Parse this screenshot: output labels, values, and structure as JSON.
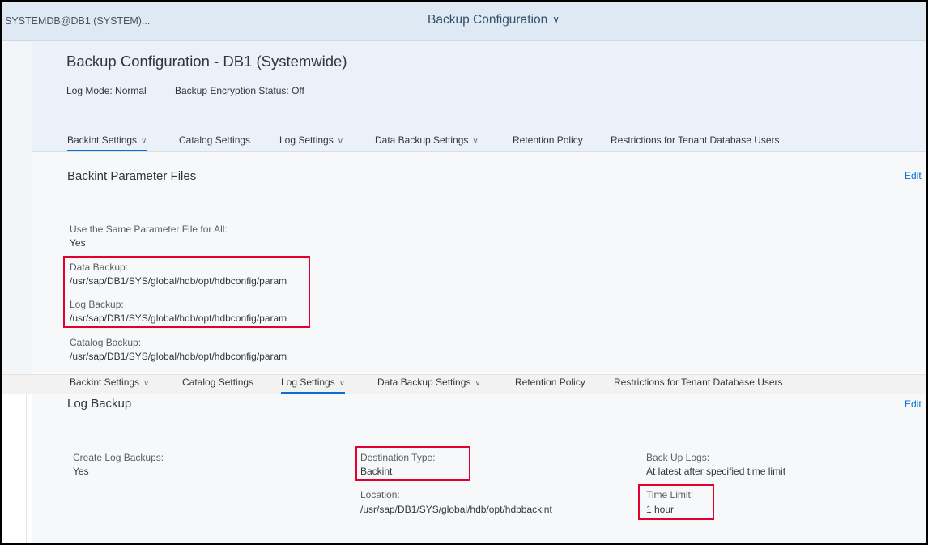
{
  "shell": {
    "user": "SYSTEMDB@DB1 (SYSTEM)...",
    "app_title": "Backup Configuration"
  },
  "header": {
    "title": "Backup Configuration - DB1 (Systemwide)",
    "log_mode": "Log Mode: Normal",
    "encryption": "Backup Encryption Status: Off"
  },
  "tabs": [
    {
      "label": "Backint Settings"
    },
    {
      "label": "Catalog Settings"
    },
    {
      "label": "Log Settings"
    },
    {
      "label": "Data Backup Settings"
    },
    {
      "label": "Retention Policy"
    },
    {
      "label": "Restrictions for Tenant Database Users"
    }
  ],
  "backint": {
    "title": "Backint Parameter Files",
    "edit": "Edit",
    "same_file_label": "Use the Same Parameter File for All:",
    "same_file_value": "Yes",
    "data_label": "Data Backup:",
    "data_value": "/usr/sap/DB1/SYS/global/hdb/opt/hdbconfig/param",
    "log_label": "Log Backup:",
    "log_value": "/usr/sap/DB1/SYS/global/hdb/opt/hdbconfig/param",
    "catalog_label": "Catalog Backup:",
    "catalog_value": "/usr/sap/DB1/SYS/global/hdb/opt/hdbconfig/param"
  },
  "log_backup": {
    "title": "Log Backup",
    "edit": "Edit",
    "create_label": "Create Log Backups:",
    "create_value": "Yes",
    "dest_label": "Destination Type:",
    "dest_value": "Backint",
    "location_label": "Location:",
    "location_value": "/usr/sap/DB1/SYS/global/hdb/opt/hdbbackint",
    "backup_logs_label": "Back Up Logs:",
    "backup_logs_value": "At latest after specified time limit",
    "time_limit_label": "Time Limit:",
    "time_limit_value": "1 hour"
  },
  "colors": {
    "accent": "#0a6ed1",
    "highlight": "#e2002f",
    "shell": "#dfe9f3"
  },
  "icons": {
    "tab_chevron": "chevron-down-icon",
    "title_chevron": "chevron-down-icon"
  }
}
